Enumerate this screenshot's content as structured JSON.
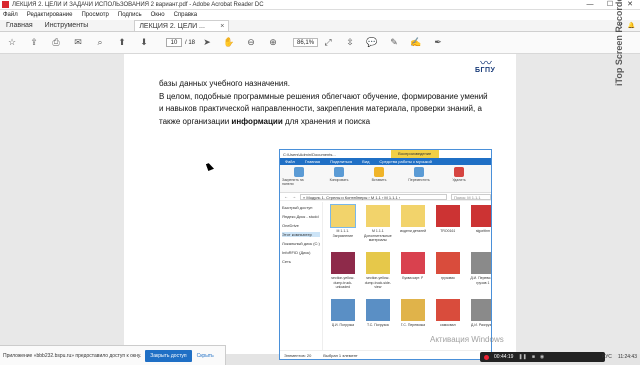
{
  "window": {
    "title": "ЛЕКЦИЯ 2. ЦЕЛИ И ЗАДАЧИ ИСПОЛЬЗОВАНИЯ 2 вариант.pdf - Adobe Acrobat Reader DC",
    "minimize": "—",
    "maximize": "☐",
    "close": "✕"
  },
  "menu": [
    "Файл",
    "Редактирование",
    "Просмотр",
    "Подпись",
    "Окно",
    "Справка"
  ],
  "tabs": {
    "home": "Главная",
    "tools": "Инструменты",
    "document": "ЛЕКЦИЯ 2. ЦЕЛИ ...",
    "document_close": "×"
  },
  "toolbar": {
    "page_current": "10",
    "page_total": "/ 18",
    "zoom": "86,1%"
  },
  "page": {
    "logo_text": "БГПУ",
    "paragraph_line1": "базы данных учебного назначения.",
    "paragraph_rest": "В целом, подобные программные решения облегчают обучение, формирование умений и навыков практической направленности, закрепления материала, проверки знаний, а также организации",
    "paragraph_bold": "информации",
    "paragraph_end": "для хранения и поиска"
  },
  "explorer": {
    "title": "C:\\Users\\Admin\\Documents...",
    "context_tab": "Воспроизведение",
    "ribbon_tabs": [
      "Файл",
      "Главная",
      "Поделиться",
      "Вид",
      "Средства работы с музыкой"
    ],
    "ribbon_groups": [
      "Закрепить на панели",
      "Копировать",
      "Вставить",
      "Переместить",
      "Удалить",
      "Переименовать",
      "Свойства"
    ],
    "address": "«  Модуль 1. Стрелы и Контейнеры  ›  М 1.1  ›  М 1.1.1  ›",
    "search_placeholder": "Поиск: М 1.1.1",
    "nav": [
      "Быстрый доступ",
      "Яндекс.Диск - studd",
      "OneDrive",
      "Этот компьютер",
      "Локальный диск (C:)",
      "InfoRFID (Диск)",
      "Сеть"
    ],
    "files": [
      {
        "name": "М 1.1.1. Загрязнение",
        "color": "#f2d36b"
      },
      {
        "name": "М 1.1.1 Дополнительные материалы",
        "color": "#f2d36b"
      },
      {
        "name": "модели деталей",
        "color": "#f2d36b"
      },
      {
        "name": "TRO0161",
        "color": "#cc3333"
      },
      {
        "name": "algorithm",
        "color": "#cc3333"
      },
      {
        "name": "section-yellow-dump-truck-unloaded",
        "color": "#8e2a4a"
      },
      {
        "name": "section-yellow-dump-truck-side-view",
        "color": "#e6c84a"
      },
      {
        "name": "Буква карт. P",
        "color": "#d9414e"
      },
      {
        "name": "грузовик",
        "color": "#d94c3c"
      },
      {
        "name": "Д.И. Перевозка грузов 1",
        "color": "#8a8a8a"
      },
      {
        "name": "Д.И. Погрузка",
        "color": "#5a8fc5"
      },
      {
        "name": "Т.С. Погрузка",
        "color": "#5a8fc5"
      },
      {
        "name": "Т.С. Перевозка",
        "color": "#e0b34a"
      },
      {
        "name": "самосвал",
        "color": "#d94c3c"
      },
      {
        "name": "Д.И. Разгрузка",
        "color": "#8a8a8a"
      }
    ],
    "status_items": "Элементов: 20",
    "status_selected": "Выбран 1 элемент"
  },
  "overlay": {
    "watermark": "iTop Screen Recorder",
    "activation": "Активация Windows",
    "notification_message": "Приложение «bbb232.bspu.ru» предоставило доступ к окну.",
    "notification_button": "Закрыть доступ",
    "notification_link": "Скрыть",
    "recording_time": "00:44:19",
    "tray_lang": "РУС",
    "tray_time": "11:24:43"
  }
}
